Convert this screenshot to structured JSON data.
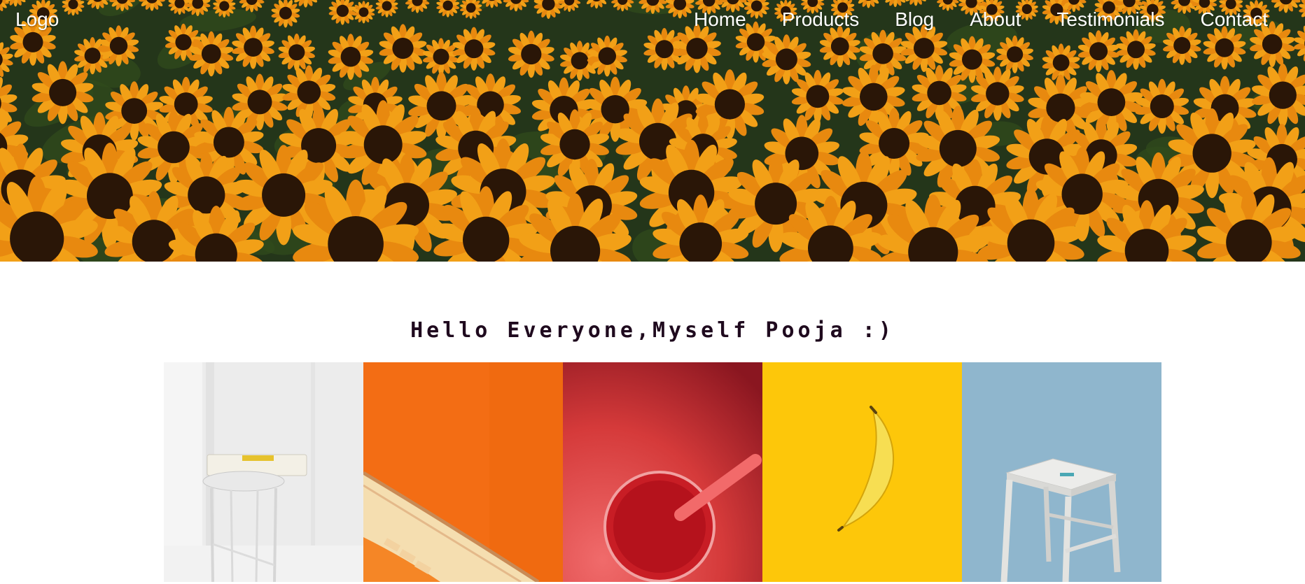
{
  "nav": {
    "logo": "Logo",
    "links": [
      "Home",
      "Products",
      "Blog",
      "About",
      "Testimonials",
      "Contact"
    ]
  },
  "hero": {
    "image": "sunflower-field",
    "colors": {
      "petal": "#f2a017",
      "center": "#2a1607",
      "leaf": "#2f4a1c"
    }
  },
  "main": {
    "greeting": "Hello Everyone,Myself Pooja :)"
  },
  "gallery": {
    "images": [
      "white-stool-with-book",
      "orange-staircase",
      "red-juice-with-straw",
      "banana-on-yellow",
      "wooden-stool-on-blue"
    ],
    "backgrounds": [
      "#ebebeb",
      "#f56e12",
      "#d23b3b",
      "#fdc80a",
      "#8eb5cc"
    ]
  }
}
